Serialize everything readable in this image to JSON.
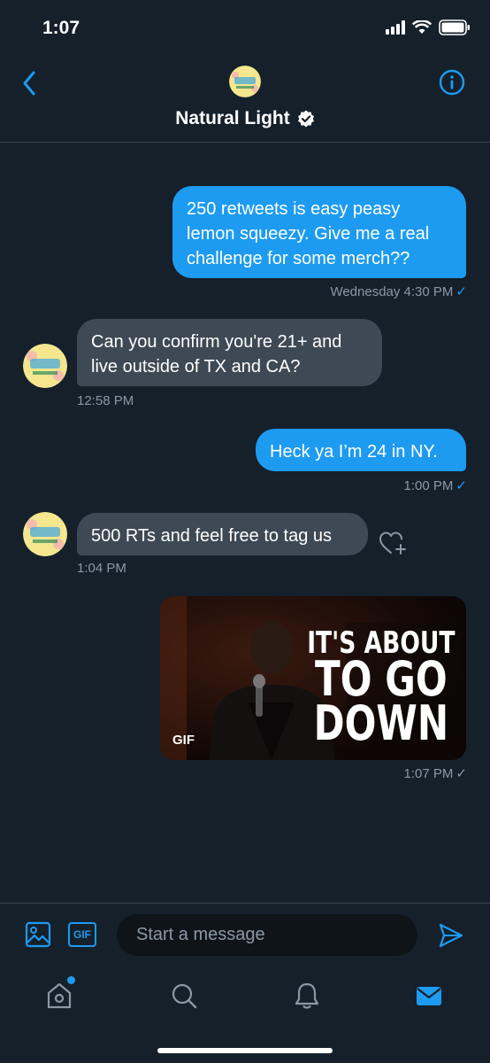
{
  "status": {
    "time": "1:07"
  },
  "header": {
    "title": "Natural Light",
    "avatar_text": "Natural Light NATURDAYS"
  },
  "messages": [
    {
      "text_lines": [
        "250 retweets is easy peasy",
        "lemon squeezy. Give me a real",
        "challenge for some merch??"
      ],
      "timestamp": "Wednesday 4:30 PM",
      "direction": "out"
    },
    {
      "text_lines": [
        "Can you confirm you're 21+ and",
        "live outside of TX and CA?"
      ],
      "timestamp": "12:58 PM",
      "direction": "in"
    },
    {
      "text_lines": [
        "Heck ya I’m 24 in NY."
      ],
      "timestamp": "1:00 PM",
      "direction": "out"
    },
    {
      "text_lines": [
        "500 RTs and feel free to tag us"
      ],
      "timestamp": "1:04 PM",
      "direction": "in"
    },
    {
      "gif_label": "GIF",
      "gif_caption": [
        "IT'S ABOUT",
        "TO GO",
        "DOWN"
      ],
      "timestamp": "1:07 PM",
      "direction": "out"
    }
  ],
  "composer": {
    "placeholder": "Start a message",
    "gif_button": "GIF"
  },
  "colors": {
    "background": "#15202b",
    "accent": "#1d9bf0",
    "incoming_bubble": "#3d4954",
    "muted_text": "#8b98a5"
  }
}
